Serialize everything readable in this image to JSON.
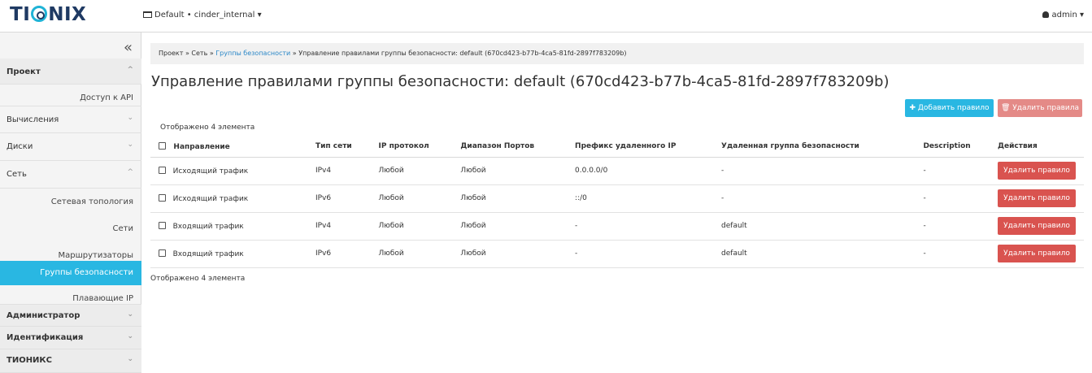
{
  "header": {
    "logo": "TIONIX",
    "project_selector": "Default • cinder_internal ▾",
    "user_menu": "admin ▾"
  },
  "sidebar": {
    "collapse_glyph": "«",
    "project": "Проект",
    "api_access": "Доступ к API",
    "compute": "Вычисления",
    "volumes": "Диски",
    "network": "Сеть",
    "network_items": [
      "Сетевая топология",
      "Сети",
      "Маршрутизаторы",
      "Группы безопасности",
      "Плавающие IP"
    ],
    "admin": "Администратор",
    "identity": "Идентификация",
    "tionix": "ТИОНИКС"
  },
  "breadcrumb": {
    "project": "Проект",
    "network": "Сеть",
    "security_groups": "Группы безопасности",
    "current": "Управление правилами группы безопасности: default (670cd423-b77b-4ca5-81fd-2897f783209b)",
    "sep": "»"
  },
  "page_title": "Управление правилами группы безопасности: default (670cd423-b77b-4ca5-81fd-2897f783209b)",
  "actions": {
    "add_rule": "✚ Добавить правило",
    "delete_rules": "🗑 Удалить правила"
  },
  "table": {
    "count_label": "Отображено 4 элемента",
    "columns": [
      "Направление",
      "Тип сети",
      "IP протокол",
      "Диапазон Портов",
      "Префикс удаленного IP",
      "Удаленная группа безопасности",
      "Description",
      "Действия"
    ],
    "rows": [
      {
        "direction": "Исходящий трафик",
        "ether": "IPv4",
        "protocol": "Любой",
        "ports": "Любой",
        "prefix": "0.0.0.0/0",
        "remote_group": "-",
        "description": "-",
        "action": "Удалить правило"
      },
      {
        "direction": "Исходящий трафик",
        "ether": "IPv6",
        "protocol": "Любой",
        "ports": "Любой",
        "prefix": "::/0",
        "remote_group": "-",
        "description": "-",
        "action": "Удалить правило"
      },
      {
        "direction": "Входящий трафик",
        "ether": "IPv4",
        "protocol": "Любой",
        "ports": "Любой",
        "prefix": "-",
        "remote_group": "default",
        "description": "-",
        "action": "Удалить правило"
      },
      {
        "direction": "Входящий трафик",
        "ether": "IPv6",
        "protocol": "Любой",
        "ports": "Любой",
        "prefix": "-",
        "remote_group": "default",
        "description": "-",
        "action": "Удалить правило"
      }
    ]
  },
  "colors": {
    "accent": "#29b7e2",
    "danger": "#d9534f",
    "danger_light": "#e48a87",
    "brand": "#1f3a63"
  }
}
